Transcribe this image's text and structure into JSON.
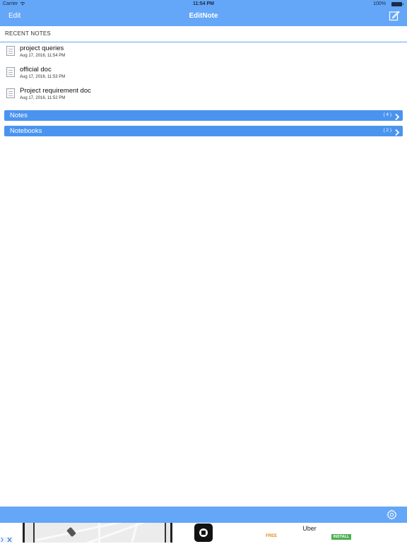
{
  "status_bar": {
    "carrier": "Carrier",
    "time": "11:54 PM",
    "battery": "100%"
  },
  "nav": {
    "edit_label": "Edit",
    "title": "EditNote",
    "compose_icon": "compose-icon"
  },
  "recent": {
    "header": "RECENT NOTES",
    "items": [
      {
        "title": "project queries",
        "date": "Aug 17, 2016, 11:54 PM"
      },
      {
        "title": "official doc",
        "date": "Aug 17, 2016, 11:53 PM"
      },
      {
        "title": "Project requirement doc",
        "date": "Aug 17, 2016, 11:52 PM"
      }
    ]
  },
  "sections": [
    {
      "label": "Notes",
      "count": "( 4 )"
    },
    {
      "label": "Notebooks",
      "count": "( 2 )"
    }
  ],
  "toolbar": {
    "settings_icon": "gear-icon"
  },
  "ad": {
    "app_name": "Uber",
    "price": "FREE",
    "install_label": "INSTALL"
  },
  "colors": {
    "bar_blue": "#64a6f7",
    "section_blue": "#4a94f0",
    "install_green": "#4caf50",
    "price_orange": "#e58a1f"
  }
}
